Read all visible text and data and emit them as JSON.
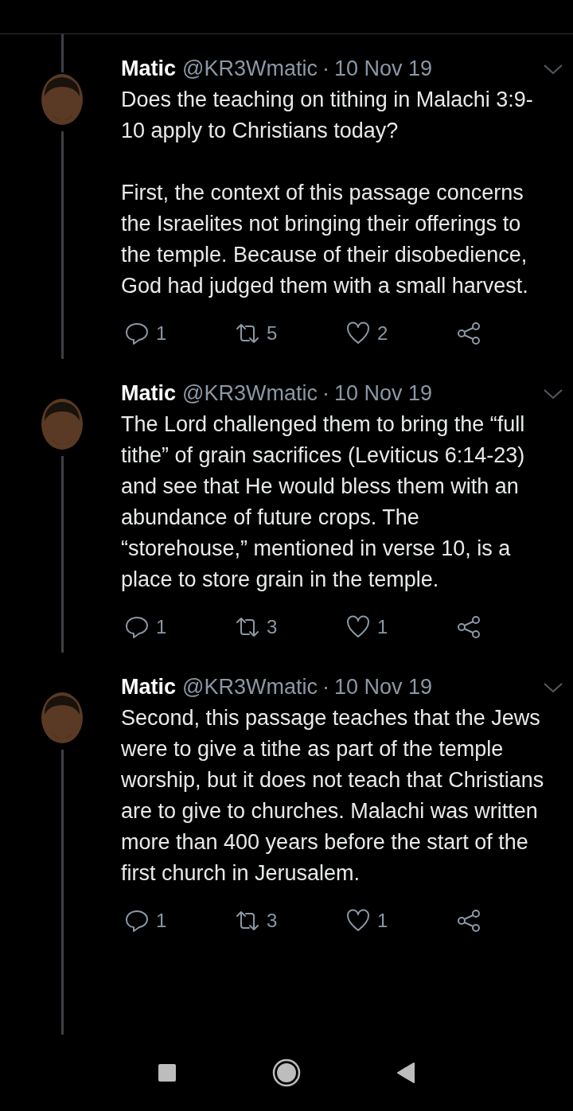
{
  "tweets": [
    {
      "name": "Matic",
      "handle": "@KR3Wmatic",
      "separator": "·",
      "date": "10 Nov 19",
      "paragraphs": [
        "Does the teaching on tithing in Malachi 3:9-10 apply to Christians today?",
        "First, the context of this passage concerns the Israelites not bringing their offerings to the temple. Because of their disobedience, God had judged them with a small harvest."
      ],
      "replies": "1",
      "retweets": "5",
      "likes": "2"
    },
    {
      "name": "Matic",
      "handle": "@KR3Wmatic",
      "separator": "·",
      "date": "10 Nov 19",
      "paragraphs": [
        "The Lord challenged them to bring the “full tithe” of grain sacrifices (Leviticus 6:14-23) and see that He would bless them with an abundance of future crops. The “storehouse,” mentioned in verse 10, is a place to store grain in the temple."
      ],
      "replies": "1",
      "retweets": "3",
      "likes": "1"
    },
    {
      "name": "Matic",
      "handle": "@KR3Wmatic",
      "separator": "·",
      "date": "10 Nov 19",
      "paragraphs": [
        "Second, this passage teaches that the Jews were to give a tithe as part of the temple worship, but it does not teach that Christians are to give to churches. Malachi was written more than 400 years before the start of the first church in Jerusalem."
      ],
      "replies": "1",
      "retweets": "3",
      "likes": "1"
    }
  ]
}
